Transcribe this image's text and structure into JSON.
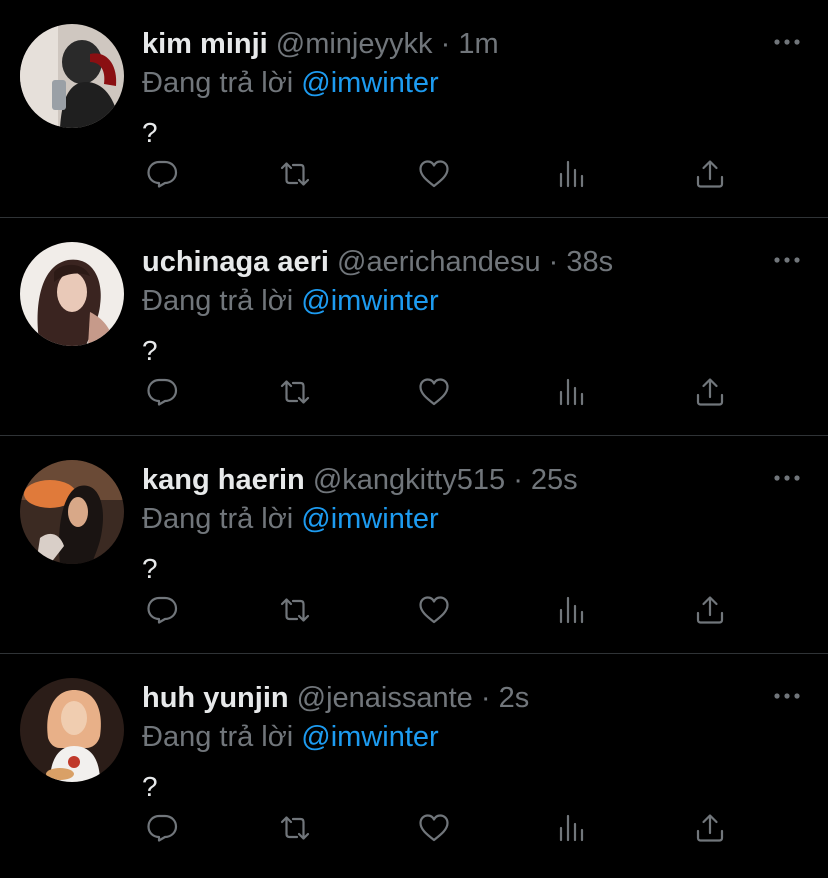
{
  "colors": {
    "background": "#000000",
    "divider": "#2f3336",
    "primary_text": "#e7e9ea",
    "secondary_text": "#71767b",
    "accent": "#1d9bf0"
  },
  "icons": {
    "more": "more-horizontal-icon",
    "reply": "comment-bubble-icon",
    "retweet": "retweet-icon",
    "like": "heart-icon",
    "views": "bar-chart-icon",
    "share": "share-upload-icon"
  },
  "separator": "·",
  "tweets": [
    {
      "display_name": "kim minji",
      "handle": "@minjeyykk",
      "time": "1m",
      "reply_prefix": "Đang trả lời",
      "reply_to": "@imwinter",
      "text": "?",
      "avatar_palette": [
        "#cfc7c0",
        "#8a0f12",
        "#2a2a2a",
        "#e6e0da"
      ]
    },
    {
      "display_name": "uchinaga aeri",
      "handle": "@aerichandesu",
      "time": "38s",
      "reply_prefix": "Đang trả lời",
      "reply_to": "@imwinter",
      "text": "?",
      "avatar_palette": [
        "#f1ede9",
        "#3a2420",
        "#c69a8a",
        "#ffffff"
      ]
    },
    {
      "display_name": "kang haerin",
      "handle": "@kangkitty515",
      "time": "25s",
      "reply_prefix": "Đang trả lời",
      "reply_to": "@imwinter",
      "text": "?",
      "avatar_palette": [
        "#3b2a22",
        "#e07a3a",
        "#1a1412",
        "#d9cfc8"
      ]
    },
    {
      "display_name": "huh yunjin",
      "handle": "@jenaissante",
      "time": "2s",
      "reply_prefix": "Đang trả lời",
      "reply_to": "@imwinter",
      "text": "?",
      "avatar_palette": [
        "#2b1d18",
        "#e8b088",
        "#f2f0ee",
        "#c0392b"
      ]
    }
  ]
}
